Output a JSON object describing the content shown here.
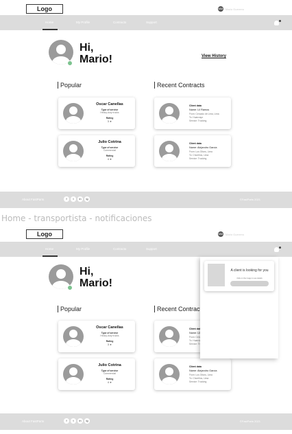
{
  "screen1": {
    "logo": "Logo",
    "user": {
      "initials": "MM",
      "name": "Mario Guerrero"
    },
    "nav": [
      "Home",
      "My Profile",
      "Contracts",
      "Support"
    ],
    "greeting_line1": "Hi,",
    "greeting_line2": "Mario!",
    "view_history": "View History",
    "popular_title": "Popular",
    "recent_title": "Recent Contracts",
    "popular": [
      {
        "name": "Oscar Canellas",
        "service_label": "Type of service",
        "service": "Heavy-duty trucks",
        "rating_label": "Rating",
        "stars": "3 ★"
      },
      {
        "name": "Julio Cotrina",
        "service_label": "Type of service",
        "service": "Commercial",
        "rating_label": "Rating",
        "stars": "4 ★"
      }
    ],
    "recent": [
      {
        "label": "Client data",
        "name": "Name: Lil Ramos",
        "line1": "From: Cercado de Lima, Lima",
        "line2": "To: Huancayo",
        "line3": "Service: Trucking"
      },
      {
        "label": "Client data",
        "name": "Name: Alejandro García",
        "line1": "From: Los Olivos, Lima",
        "line2": "To: Chorrillos, Lima",
        "line3": "Service: Trucking"
      }
    ],
    "footer_about": "About FastParts",
    "social": [
      "f",
      "t",
      "in",
      "ig"
    ],
    "footer_copy": "©FastParts 2021"
  },
  "caption": "Home - transportista - notificaciones",
  "screen2": {
    "logo": "Logo",
    "user": {
      "initials": "MM",
      "name": "Mario Guerrero"
    },
    "nav": [
      "Home",
      "My Profile",
      "Contracts",
      "Support"
    ],
    "greeting_line1": "Hi,",
    "greeting_line2": "Mario!",
    "popular_title": "Popular",
    "recent_title": "Recent Contracts",
    "popular": [
      {
        "name": "Oscar Canellas",
        "service_label": "Type of service",
        "service": "Heavy-duty trucks",
        "rating_label": "Rating",
        "stars": "3 ★"
      },
      {
        "name": "Julio Cotrina",
        "service_label": "Type of service",
        "service": "Commercial",
        "rating_label": "Rating",
        "stars": "4 ★"
      }
    ],
    "recent": [
      {
        "label": "Client data",
        "name": "Name: Lil Ramos",
        "line1": "From: Cercado de Lima, Lima",
        "line2": "To: Huancayo",
        "line3": "Service: Trucking"
      },
      {
        "label": "Client data",
        "name": "Name: Alejandro García",
        "line1": "From: Los Olivos, Lima",
        "line2": "To: Chorrillos, Lima",
        "line3": "Service: Trucking"
      }
    ],
    "notification": {
      "title": "A client is looking for you",
      "subtitle": "Click on the image to see details"
    },
    "footer_about": "About FastParts",
    "social": [
      "f",
      "t",
      "in",
      "ig"
    ],
    "footer_copy": "©FastParts 2021"
  },
  "colors": {
    "navbar": "#dcdcdc",
    "accent_online": "#7cc38f",
    "avatar": "#9b9b9b"
  }
}
